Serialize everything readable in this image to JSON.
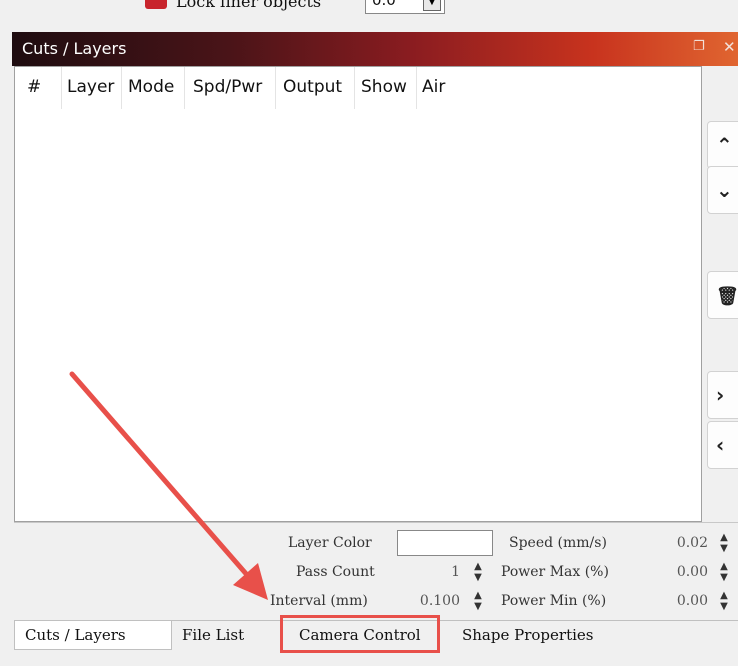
{
  "top_option": {
    "label": "Lock finer objects",
    "spin_value": "0.0"
  },
  "window": {
    "title": "Cuts / Layers",
    "float_icon": "float-window-icon",
    "close_icon": "close-icon"
  },
  "layers_table": {
    "columns": [
      "#",
      "Layer",
      "Mode",
      "Spd/Pwr",
      "Output",
      "Show",
      "Air"
    ],
    "rows": []
  },
  "sidebar": {
    "buttons": [
      {
        "icon": "chevron-up-icon",
        "glyph": "^"
      },
      {
        "icon": "chevron-down-icon",
        "glyph": "⌄"
      },
      {
        "icon": "trash-icon",
        "glyph": "🗑"
      },
      {
        "icon": "chevron-right-icon",
        "glyph": "›"
      },
      {
        "icon": "chevron-left-icon",
        "glyph": "‹"
      }
    ]
  },
  "properties": {
    "layer_color_label": "Layer Color",
    "pass_count_label": "Pass Count",
    "pass_count_value": "1",
    "interval_label": "Interval (mm)",
    "interval_value": "0.100",
    "speed_label": "Speed (mm/s)",
    "speed_value": "0.02",
    "power_max_label": "Power Max (%)",
    "power_max_value": "0.00",
    "power_min_label": "Power Min (%)",
    "power_min_value": "0.00"
  },
  "tabs": [
    "Cuts / Layers",
    "File List",
    "Camera Control",
    "Shape Properties"
  ],
  "annotation": {
    "color": "#e8504a",
    "target": "Camera Control"
  }
}
